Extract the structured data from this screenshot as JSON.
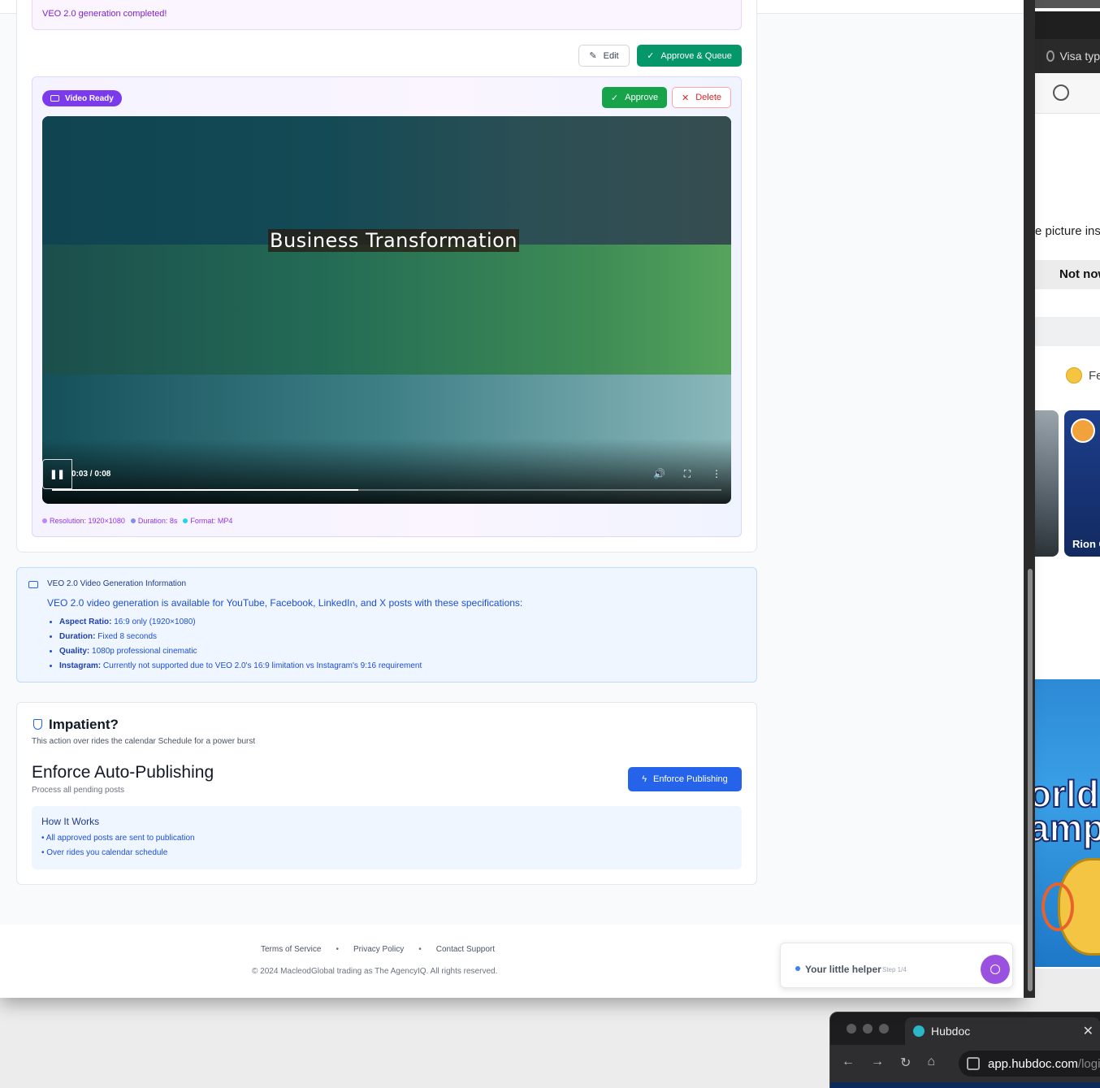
{
  "status": {
    "completed_text": "VEO 2.0 generation completed!"
  },
  "actions": {
    "edit_label": "Edit",
    "approve_queue_label": "Approve & Queue"
  },
  "video_card": {
    "badge_label": "Video Ready",
    "approve_label": "Approve",
    "delete_label": "Delete",
    "video_title": "Business Transformation",
    "time_display": "0:03 / 0:08",
    "progress_fraction": 0.458,
    "meta": [
      {
        "text": "Resolution: 1920×1080",
        "color": "#c084fc"
      },
      {
        "text": "Duration: 8s",
        "color": "#818cf8"
      },
      {
        "text": "Format: MP4",
        "color": "#22d3ee"
      }
    ]
  },
  "info": {
    "title": "VEO 2.0 Video Generation Information",
    "lead": "VEO 2.0 video generation is available for YouTube, Facebook, LinkedIn, and X posts with these specifications:",
    "items": [
      {
        "label": "Aspect Ratio:",
        "value": "16:9 only (1920×1080)"
      },
      {
        "label": "Duration:",
        "value": "Fixed 8 seconds"
      },
      {
        "label": "Quality:",
        "value": "1080p professional cinematic"
      },
      {
        "label": "Instagram:",
        "value": "Currently not supported due to VEO 2.0's 16:9 limitation vs Instagram's 9:16 requirement"
      }
    ]
  },
  "impatient": {
    "title": "Impatient?",
    "subtitle": "This action over rides the calendar Schedule for a power burst",
    "enforce_title": "Enforce Auto-Publishing",
    "enforce_sub": "Process all pending posts",
    "enforce_button": "Enforce Publishing",
    "how_title": "How It Works",
    "how_items": [
      "• All approved posts are sent to publication",
      "• Over rides you calendar schedule"
    ]
  },
  "footer": {
    "links": [
      "Terms of Service",
      "Privacy Policy",
      "Contact Support"
    ],
    "separator": "•",
    "copyright": "© 2024 MacleodGlobal trading as The AgencyIQ. All rights reserved."
  },
  "helper": {
    "title": "Your little helper",
    "step": "Step 1/4"
  },
  "background_window": {
    "tab_text": "Visa typ",
    "partial_text": "e picture ins",
    "not_now": "Not now",
    "feel_text": "Fe",
    "card_name": "Rion C",
    "image_text_1": "orld",
    "image_text_2": "amp"
  },
  "hubdoc": {
    "tab_title": "Hubdoc",
    "url_main": "app.hubdoc.com",
    "url_rest": "/logi"
  }
}
